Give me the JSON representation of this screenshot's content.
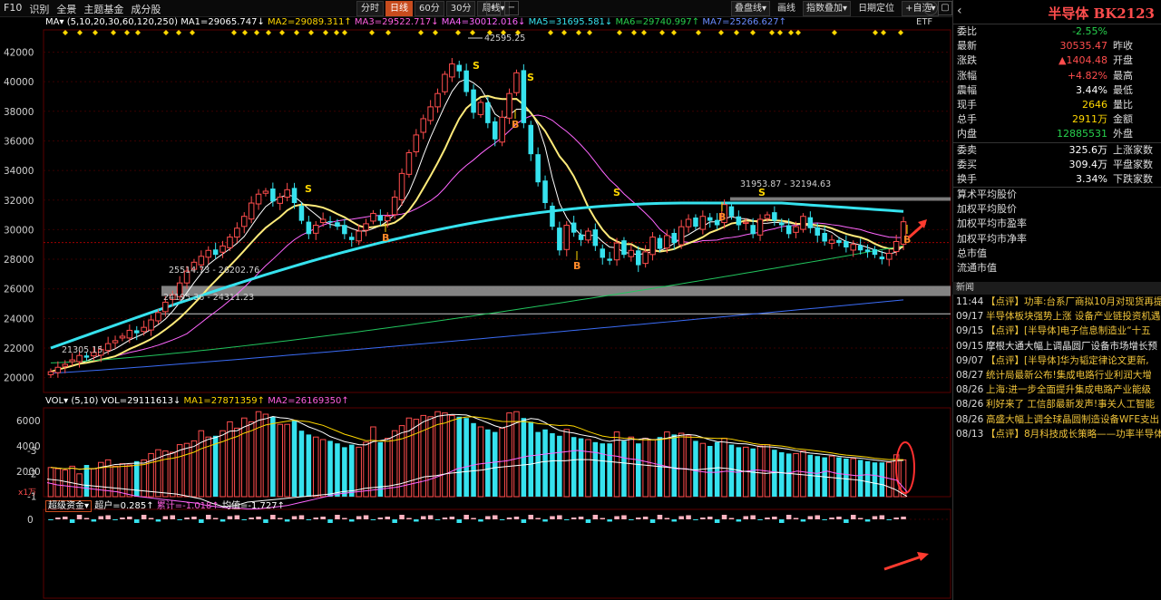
{
  "topbar": {
    "nav": [
      "F10",
      "识别",
      "全景",
      "主题基金",
      "成分股"
    ],
    "periods": [
      "分时",
      "日线",
      "60分",
      "30分",
      "周线▾"
    ],
    "active_period": "日线",
    "zoom_in": "+",
    "zoom_out": "−",
    "tools": [
      "叠盘线▾",
      "画线",
      "指数叠加▾",
      "日期定位",
      "+自选▾"
    ],
    "help": "?"
  },
  "ma_bar": {
    "label": "MA▾",
    "params": "(5,10,20,30,60,120,250)",
    "ma1": "MA1=29065.747↓",
    "ma2": "MA2=29089.311↑",
    "ma3": "MA3=29522.717↓",
    "ma4": "MA4=30012.016↓",
    "ma5": "MA5=31695.581↓",
    "ma6": "MA6=29740.997↑",
    "ma7": "MA7=25266.627↑"
  },
  "etf_label": "ETF",
  "price_axis": [
    "42000",
    "40000",
    "38000",
    "36000",
    "34000",
    "32000",
    "30000",
    "28000",
    "26000",
    "24000",
    "22000",
    "20000"
  ],
  "annotations": {
    "high": "42595.25",
    "low": "21305.15",
    "zone1": "25514.73 - 26202.76",
    "zone2": "24195.36 - 24311.23",
    "zone3": "31953.87 - 32194.63"
  },
  "signals": {
    "buy": "B",
    "sell": "S"
  },
  "vol_bar": {
    "label": "VOL▾",
    "params": "(5,10)",
    "vol": "VOL=29111613↓",
    "ma1": "MA1=27871359↑",
    "ma2": "MA2=26169350↑"
  },
  "vol_axis": [
    "6000",
    "4000",
    "2000"
  ],
  "vol_unit": "x1万",
  "fund_bar": {
    "label": "超级资金▾",
    "super": "超户=0.285↑",
    "cum": "累计=-1.018↑",
    "avg": "均值=-1.727↑"
  },
  "fund_axis": [
    "0",
    "-1",
    "-2",
    "-3"
  ],
  "right_panel": {
    "back": "‹",
    "title": "半导体 BK2123",
    "quotes": [
      {
        "l1": "委比",
        "v1": "-2.55%",
        "c1": "green",
        "l2": ""
      },
      {
        "l1": "最新",
        "v1": "30535.47",
        "c1": "red",
        "l2": "昨收"
      },
      {
        "l1": "涨跌",
        "v1": "▲1404.48",
        "c1": "red",
        "l2": "开盘"
      },
      {
        "l1": "涨幅",
        "v1": "+4.82%",
        "c1": "red",
        "l2": "最高"
      },
      {
        "l1": "震幅",
        "v1": "3.44%",
        "c1": "white",
        "l2": "最低"
      },
      {
        "l1": "现手",
        "v1": "2646",
        "c1": "yellow",
        "l2": "量比"
      },
      {
        "l1": "总手",
        "v1": "2911万",
        "c1": "yellow",
        "l2": "金额"
      },
      {
        "l1": "内盘",
        "v1": "12885531",
        "c1": "green",
        "l2": "外盘"
      }
    ],
    "quotes2": [
      {
        "l1": "委卖",
        "v1": "325.6万",
        "c1": "white",
        "l2": "上涨家数"
      },
      {
        "l1": "委买",
        "v1": "309.4万",
        "c1": "white",
        "l2": "平盘家数"
      },
      {
        "l1": "换手",
        "v1": "3.34%",
        "c1": "white",
        "l2": "下跌家数"
      }
    ],
    "stats": [
      "算术平均股价",
      "加权平均股价",
      "加权平均市盈率",
      "加权平均市净率",
      "总市值",
      "流通市值"
    ],
    "news_tab": "新闻",
    "news": [
      {
        "t": "11:44",
        "c": "【点评】功率:台系厂商拟10月对现货再提",
        "w": false
      },
      {
        "t": "09/17",
        "c": "半导体板块强势上涨 设备产业链投资机遇",
        "w": false
      },
      {
        "t": "09/15",
        "c": "【点评】[半导体]电子信息制造业“十五",
        "w": false
      },
      {
        "t": "09/15",
        "c": "摩根大通大幅上调晶圆厂设备市场增长预",
        "w": true
      },
      {
        "t": "09/07",
        "c": "【点评】[半导体]华为韬定律论文更新,",
        "w": false
      },
      {
        "t": "08/27",
        "c": "统计局最新公布!集成电路行业利润大增",
        "w": false
      },
      {
        "t": "08/26",
        "c": "上海:进一步全面提升集成电路产业能级",
        "w": false
      },
      {
        "t": "08/26",
        "c": "利好来了 工信部最新发声!事关人工智能",
        "w": false
      },
      {
        "t": "08/26",
        "c": "高盛大幅上调全球晶圆制造设备WFE支出",
        "w": false
      },
      {
        "t": "08/13",
        "c": "【点评】8月科技成长策略——功率半导体",
        "w": false
      }
    ]
  },
  "chart_data": {
    "type": "candlestick",
    "ymin": 19000,
    "ymax": 43500,
    "ma_colors": {
      "ma5": "#ffffff",
      "ma10": "#ffeb7a",
      "ma20": "#ff66ff",
      "ma60": "#36e2ee",
      "ma120": "#22c55e",
      "ma250": "#3b6cf6"
    },
    "up_color": "#ff4d4d",
    "down_color": "#36e2ee",
    "closes": [
      20400,
      20700,
      20900,
      21200,
      21500,
      21350,
      21700,
      21900,
      22300,
      22500,
      22800,
      23200,
      23000,
      23400,
      23900,
      24400,
      25100,
      25600,
      26400,
      27200,
      27800,
      28200,
      28600,
      28300,
      28900,
      29500,
      30100,
      30900,
      31800,
      32400,
      32600,
      31900,
      32200,
      32700,
      31800,
      30600,
      29700,
      30300,
      30700,
      30500,
      30200,
      29700,
      29300,
      29900,
      30400,
      31100,
      30600,
      30900,
      32200,
      33800,
      35200,
      36400,
      37500,
      38300,
      39200,
      40500,
      41200,
      40700,
      39300,
      37900,
      38600,
      37200,
      36100,
      37600,
      39200,
      40600,
      37200,
      35100,
      33200,
      31800,
      30200,
      28600,
      30300,
      29800,
      29300,
      29900,
      28900,
      28100,
      27900,
      29100,
      28300,
      28600,
      27600,
      28500,
      29500,
      28700,
      29600,
      29100,
      30200,
      30700,
      30200,
      30900,
      30600,
      30300,
      31700,
      30900,
      30300,
      30500,
      29700,
      30700,
      31000,
      30600,
      30300,
      29700,
      30200,
      30900,
      30100,
      29600,
      29200,
      29300,
      29100,
      28800,
      29000,
      28600,
      28500,
      28300,
      28000,
      28400,
      29200,
      30535
    ],
    "volumes": [
      2300,
      2200,
      2100,
      2400,
      1800,
      2500,
      2200,
      2700,
      2900,
      2400,
      2600,
      2500,
      2800,
      2900,
      3400,
      3700,
      3600,
      3500,
      4100,
      4200,
      4400,
      5200,
      4700,
      4800,
      5200,
      5900,
      5400,
      6200,
      5900,
      6700,
      6500,
      6300,
      5700,
      5700,
      6000,
      5200,
      4900,
      4700,
      4500,
      4400,
      4200,
      3900,
      4100,
      3900,
      4300,
      5500,
      4300,
      4600,
      5200,
      5600,
      6200,
      6100,
      6400,
      6300,
      6700,
      6600,
      6400,
      6300,
      6200,
      5800,
      5500,
      5300,
      5100,
      5400,
      6600,
      6700,
      6200,
      5900,
      5100,
      5300,
      5000,
      4800,
      5300,
      4700,
      4600,
      4500,
      4300,
      4200,
      4200,
      5100,
      4400,
      4700,
      4200,
      4600,
      4500,
      4700,
      5100,
      4900,
      5000,
      4800,
      4400,
      4200,
      4000,
      4300,
      4600,
      4100,
      3900,
      3900,
      3800,
      4000,
      4100,
      3700,
      3500,
      3400,
      3400,
      3600,
      3300,
      3200,
      3100,
      3200,
      3100,
      3000,
      3000,
      2900,
      2800,
      2700,
      2700,
      2700,
      3300,
      2900
    ],
    "fund_avg": [
      -1.6,
      -1.5,
      -1.45,
      -1.4,
      -1.35,
      -1.3,
      -1.25,
      -1.2,
      -1.1,
      -1.0,
      -0.95,
      -0.9,
      -0.85,
      -0.8,
      -0.75,
      -0.7,
      -0.6,
      -0.55,
      -0.5,
      -0.5,
      -0.45,
      -0.45,
      -0.5,
      -0.55,
      -0.6,
      -0.7,
      -0.8,
      -0.9,
      -1.0,
      -1.1,
      -1.15,
      -1.2,
      -1.25,
      -1.3,
      -1.35,
      -1.4,
      -1.5,
      -1.6,
      -1.7,
      -1.85,
      -2.0,
      -2.2,
      -2.3,
      -2.4,
      -2.45,
      -2.5,
      -2.55,
      -2.65,
      -2.75,
      -2.8,
      -2.85,
      -2.9,
      -2.95,
      -3.0,
      -2.95,
      -2.9,
      -2.8,
      -2.75,
      -2.65,
      -2.6,
      -2.5,
      -2.4,
      -2.3,
      -2.2,
      -2.2,
      -2.1,
      -2.05,
      -2.05,
      -2.1,
      -2.05,
      -2.1,
      -2.15,
      -2.1,
      -2.05,
      -2.0,
      -2.1,
      -2.05,
      -2.0,
      -2.1,
      -2.0,
      -1.95,
      -1.9,
      -1.95,
      -1.9,
      -1.8,
      -1.7,
      -1.2
    ],
    "fund_cum": [
      -1.75,
      -1.7,
      -1.6,
      -1.5,
      -1.45,
      -1.4,
      -1.35,
      -1.3,
      -1.25,
      -1.2,
      -1.15,
      -1.1,
      -1.0,
      -0.9,
      -0.7,
      -0.55,
      -0.6,
      -0.75,
      -0.8,
      -0.85,
      -0.9,
      -0.95,
      -1.0,
      -1.05,
      -1.1,
      -1.2,
      -1.25,
      -1.35,
      -1.4,
      -1.45,
      -1.55,
      -1.7,
      -1.85,
      -1.9,
      -2.0,
      -2.05,
      -2.1,
      -2.15,
      -2.25,
      -2.3,
      -2.35,
      -2.4,
      -2.5,
      -2.55,
      -2.55,
      -2.6,
      -2.6,
      -2.55,
      -2.5,
      -2.45,
      -2.4,
      -2.35,
      -2.3,
      -2.25,
      -2.2,
      -2.15,
      -2.2,
      -2.25,
      -2.2,
      -2.1,
      -2.05,
      -2.0,
      -2.05,
      -2.0,
      -1.95,
      -1.9,
      -1.85,
      -1.8,
      -1.75,
      -1.7,
      -1.6,
      -1.5,
      -1.3,
      -1.0
    ]
  }
}
